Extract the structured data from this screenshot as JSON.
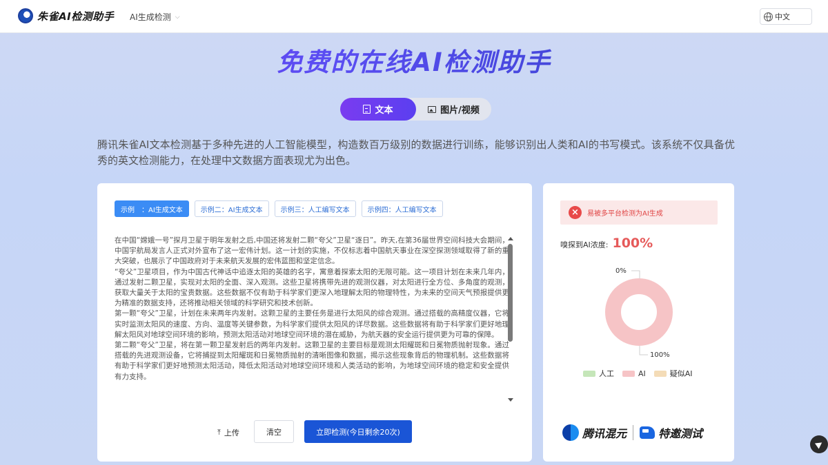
{
  "header": {
    "brand": "朱雀AI检测助手",
    "nav_item": "AI生成检测",
    "language": "中文"
  },
  "hero": {
    "title": "免费的在线AI检测助手",
    "tabs": [
      {
        "label": "文本",
        "active": true
      },
      {
        "label": "图片/视频",
        "active": false
      }
    ],
    "description": "腾讯朱雀AI文本检测基于多种先进的人工智能模型，构造数百万级别的数据进行训练，能够识别出人类和AI的书写模式。该系统不仅具备优秀的英文检测能力，在处理中文数据方面表现尤为出色。"
  },
  "editor": {
    "examples": [
      {
        "label": "示例　：AI生成文本",
        "active": true
      },
      {
        "label": "示例二：AI生成文本",
        "active": false
      },
      {
        "label": "示例三：人工编写文本",
        "active": false
      },
      {
        "label": "示例四：人工编写文本",
        "active": false
      }
    ],
    "paragraphs": [
      "在中国“嫦娥一号”探月卫星于明年发射之后,中国还将发射二颗“夸父”卫星“逐日”。昨天,在第36届世界空间科技大会期间，中国宇航局发言人正式对外宣布了这一宏伟计划。这一计划的实施，不仅标志着中国航天事业在深空探测领域取得了新的重大突破，也展示了中国政府对于未来航天发展的宏伟蓝图和坚定信念。",
      "“夸父”卫星项目，作为中国古代神话中追逐太阳的英雄的名字，寓意着探索太阳的无限可能。这一项目计划在未来几年内，通过发射二颗卫星，实现对太阳的全面、深入观测。这些卫星将携带先进的观测仪器，对太阳进行全方位、多角度的观测，获取大量关于太阳的宝贵数据。这些数据不仅有助于科学家们更深入地理解太阳的物理特性，为未来的空间天气预报提供更为精准的数据支持，还将推动相关领域的科学研究和技术创新。",
      "第一颗“夸父”卫星，计划在未来两年内发射。这颗卫星的主要任务是进行太阳风的综合观测。通过搭载的高精度仪器，它将实时监测太阳风的速度、方向、温度等关键参数，为科学家们提供太阳风的详尽数据。这些数据将有助于科学家们更好地理解太阳风对地球空间环境的影响，预测太阳活动对地球空间环境的潜在威胁，为航天器的安全运行提供更为可靠的保障。",
      "第二颗“夸父”卫星，将在第一颗卫星发射后的两年内发射。这颗卫星的主要目标是观测太阳耀斑和日冕物质抛射现象。通过搭载的先进观测设备，它将捕捉到太阳耀斑和日冕物质抛射的清晰图像和数据，揭示这些现象背后的物理机制。这些数据将有助于科学家们更好地预测太阳活动，降低太阳活动对地球空间环境和人类活动的影响，为地球空间环境的稳定和安全提供有力支持。"
    ],
    "upload_label": "上传",
    "clear_label": "清空",
    "detect_label": "立即检测(今日剩余20次)"
  },
  "result": {
    "alert_text": "易被多平台检测为AI生成",
    "concentration_label": "嗅探到AI浓度:",
    "concentration_value": "100%",
    "donut_labels": {
      "zero": "0%",
      "full": "100%"
    },
    "chart_data": {
      "type": "pie",
      "values": [
        0,
        100,
        0
      ],
      "categories": [
        "人工",
        "AI",
        "疑似AI"
      ],
      "colors": [
        "#c5e6b9",
        "#f6c4c6",
        "#f4dcb7"
      ],
      "legend": "bottom"
    },
    "brands": {
      "left": "腾讯混元",
      "right": "特邀测试"
    }
  }
}
